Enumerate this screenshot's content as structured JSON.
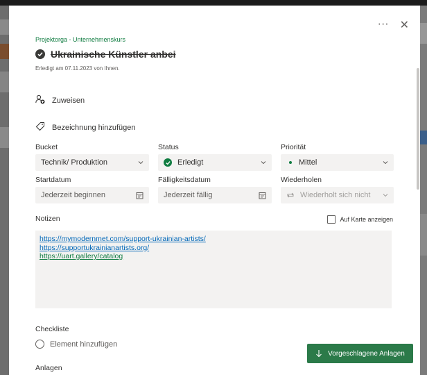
{
  "header": {
    "more_label": "···",
    "close_label": "✕"
  },
  "task": {
    "plan_name": "Projektorga - Unternehmenskurs",
    "title": "Ukrainische Künstler anbei",
    "completed_note": "Erledigt am 07.11.2023 von Ihnen."
  },
  "actions": {
    "assign_label": "Zuweisen",
    "label_add": "Bezeichnung hinzufügen"
  },
  "fields": {
    "bucket": {
      "label": "Bucket",
      "value": "Technik/ Produktion"
    },
    "status": {
      "label": "Status",
      "value": "Erledigt"
    },
    "priority": {
      "label": "Priorität",
      "value": "Mittel"
    },
    "start_date": {
      "label": "Startdatum",
      "placeholder": "Jederzeit beginnen"
    },
    "due_date": {
      "label": "Fälligkeitsdatum",
      "placeholder": "Jederzeit fällig"
    },
    "repeat": {
      "label": "Wiederholen",
      "value": "Wiederholt sich nicht"
    }
  },
  "notes": {
    "label": "Notizen",
    "show_on_card_label": "Auf Karte anzeigen",
    "links": [
      "https://mymodernmet.com/support-ukrainian-artists/",
      "https://supportukrainianartists.org/",
      "https://uart.gallery/catalog"
    ]
  },
  "checklist": {
    "label": "Checkliste",
    "add_item_label": "Element hinzufügen"
  },
  "attachments": {
    "label": "Anlagen",
    "suggest_button_label": "Vorgeschlagene Anlagen"
  },
  "colors": {
    "accent_green": "#107c41",
    "link_blue": "#0067b8",
    "button_green": "#2b7a49"
  }
}
